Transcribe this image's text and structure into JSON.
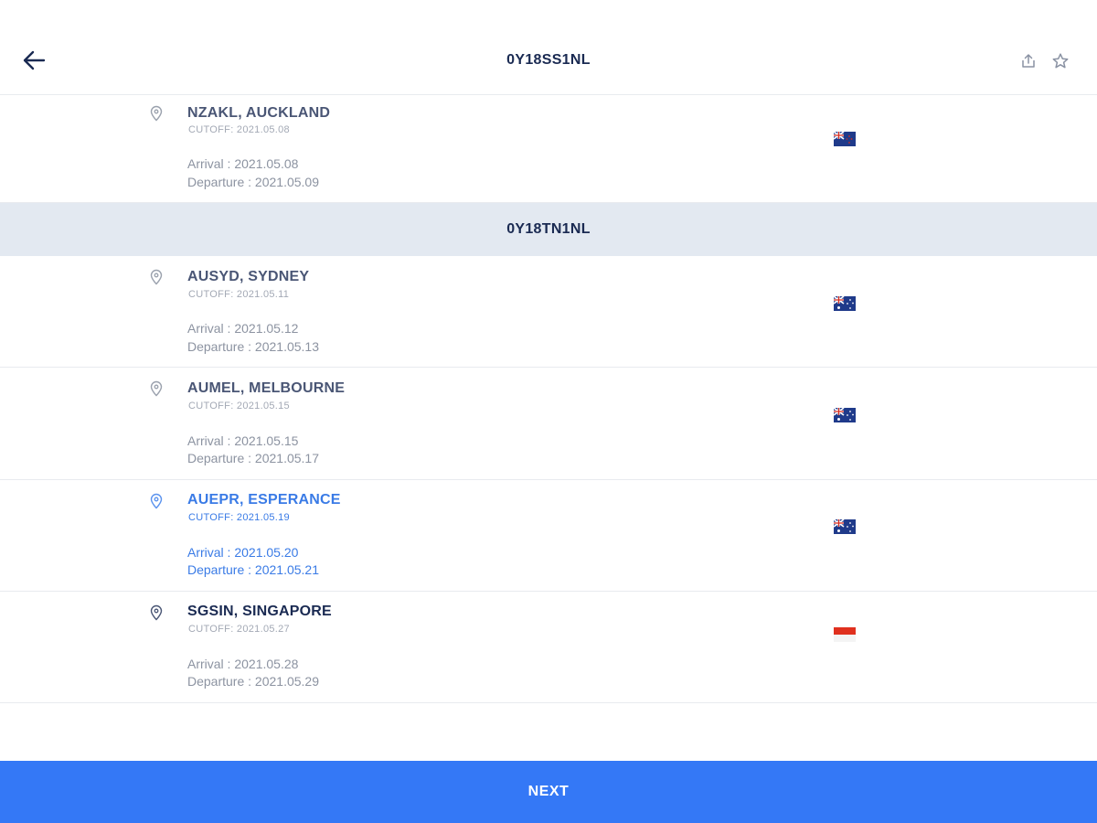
{
  "header": {
    "title": "0Y18SS1NL",
    "back_icon": "arrow-left-icon",
    "share_icon": "share-upload-icon",
    "star_icon": "star-outline-icon"
  },
  "section_1": {
    "ports": [
      {
        "name": "NZAKL, AUCKLAND",
        "cutoff": "CUTOFF: 2021.05.08",
        "arrival": "Arrival : 2021.05.08",
        "departure": "Departure : 2021.05.09",
        "flag": "new-zealand-flag-icon"
      }
    ]
  },
  "section_2": {
    "title": "0Y18TN1NL",
    "ports": [
      {
        "name": "AUSYD, SYDNEY",
        "cutoff": "CUTOFF: 2021.05.11",
        "arrival": "Arrival : 2021.05.12",
        "departure": "Departure : 2021.05.13",
        "flag": "australia-flag-icon"
      },
      {
        "name": "AUMEL, MELBOURNE",
        "cutoff": "CUTOFF: 2021.05.15",
        "arrival": "Arrival : 2021.05.15",
        "departure": "Departure : 2021.05.17",
        "flag": "australia-flag-icon"
      },
      {
        "name": "AUEPR, ESPERANCE",
        "cutoff": "CUTOFF: 2021.05.19",
        "arrival": "Arrival : 2021.05.20",
        "departure": "Departure : 2021.05.21",
        "flag": "australia-flag-icon",
        "state": "selected"
      },
      {
        "name": "SGSIN, SINGAPORE",
        "cutoff": "CUTOFF: 2021.05.27",
        "arrival": "Arrival : 2021.05.28",
        "departure": "Departure : 2021.05.29",
        "flag": "singapore-flag-icon"
      }
    ]
  },
  "footer": {
    "next_label": "NEXT"
  },
  "colors": {
    "primary": "#3478f6",
    "selected_text": "#3a7be6",
    "title_text": "#1a2a52",
    "section_bg": "#e3e9f1"
  }
}
